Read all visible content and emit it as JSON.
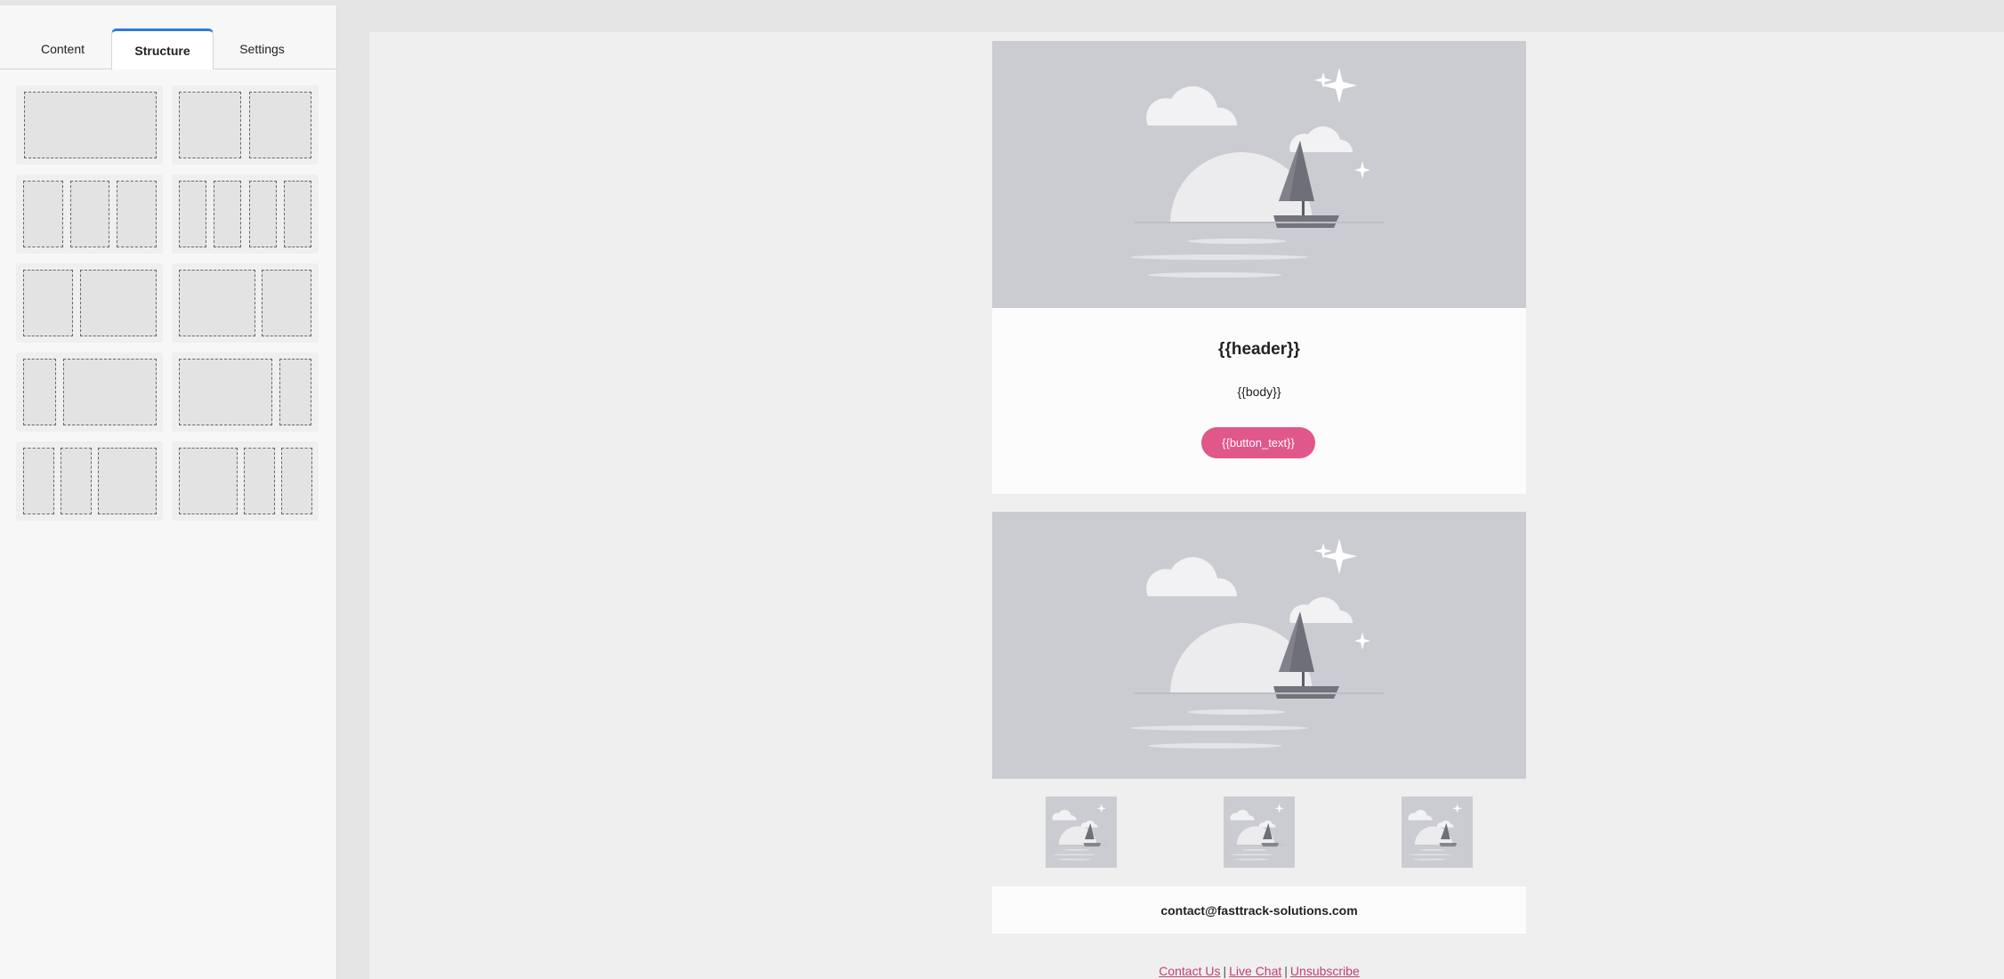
{
  "tabs": [
    {
      "label": "Content"
    },
    {
      "label": "Structure",
      "active": true
    },
    {
      "label": "Settings"
    }
  ],
  "layouts": [
    {
      "name": "1 column"
    },
    {
      "name": "2 columns"
    },
    {
      "name": "3 columns"
    },
    {
      "name": "4 columns"
    },
    {
      "name": "1/3 - 2/3"
    },
    {
      "name": "2/3 - 1/3"
    },
    {
      "name": "1/4 - 3/4"
    },
    {
      "name": "3/4 - 1/4"
    },
    {
      "name": "1/4 - 1/4 - 1/2"
    },
    {
      "name": "1/2 - 1/4 - 1/4"
    }
  ],
  "email": {
    "header": "{{header}}",
    "body": "{{body}}",
    "button_text": "{{button_text}}",
    "contact_email": "contact@fasttrack-solutions.com",
    "links": [
      "Contact Us",
      "Live Chat",
      "Unsubscribe"
    ]
  },
  "colors": {
    "accent_tab": "#2a7cd4",
    "button": "#e0578a",
    "link": "#c23c74",
    "placeholder_image": "#cbccd1"
  }
}
